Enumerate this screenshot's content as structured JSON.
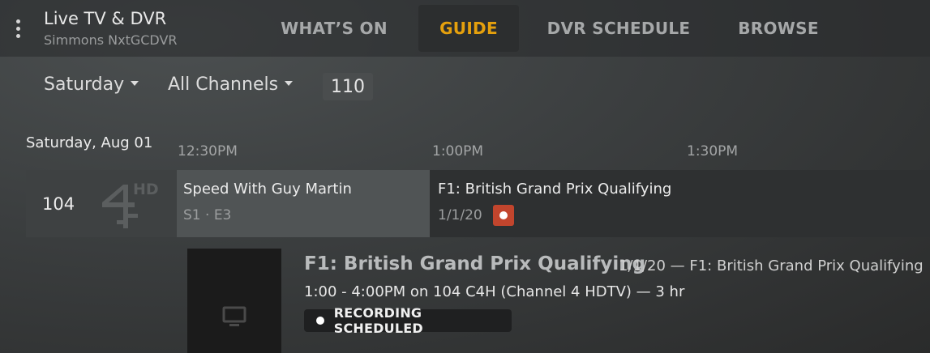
{
  "header": {
    "app_title": "Live TV & DVR",
    "server_name": "Simmons NxtGCDVR",
    "tabs": [
      {
        "label": "WHAT’S ON",
        "active": false
      },
      {
        "label": "GUIDE",
        "active": true
      },
      {
        "label": "DVR SCHEDULE",
        "active": false
      },
      {
        "label": "BROWSE",
        "active": false
      }
    ],
    "accent_color": "#e5a00d"
  },
  "filters": {
    "day": "Saturday",
    "channels": "All Channels",
    "channel_jump": "110"
  },
  "guide": {
    "date": "Saturday, Aug 01",
    "times": [
      "12:30PM",
      "1:00PM",
      "1:30PM"
    ],
    "row": {
      "channel_number": "104",
      "channel_logo": "channel-4-hd-logo",
      "logo_hd_text": "HD",
      "programs": [
        {
          "title": "Speed With Guy Martin",
          "meta": "S1 · E3",
          "selected": true
        },
        {
          "title": "F1: British Grand Prix Qualifying",
          "meta": "1/1/20",
          "recording": true
        }
      ]
    }
  },
  "detail": {
    "title": "F1: British Grand Prix Qualifying",
    "subtitle": "1/1/20 — F1: British Grand Prix Qualifying",
    "airing": "1:00 - 4:00PM on 104 C4H (Channel 4 HDTV) — 3 hr",
    "status": "RECORDING SCHEDULED",
    "poster_icon": "tv-icon",
    "recording_color": "#c2452d"
  }
}
